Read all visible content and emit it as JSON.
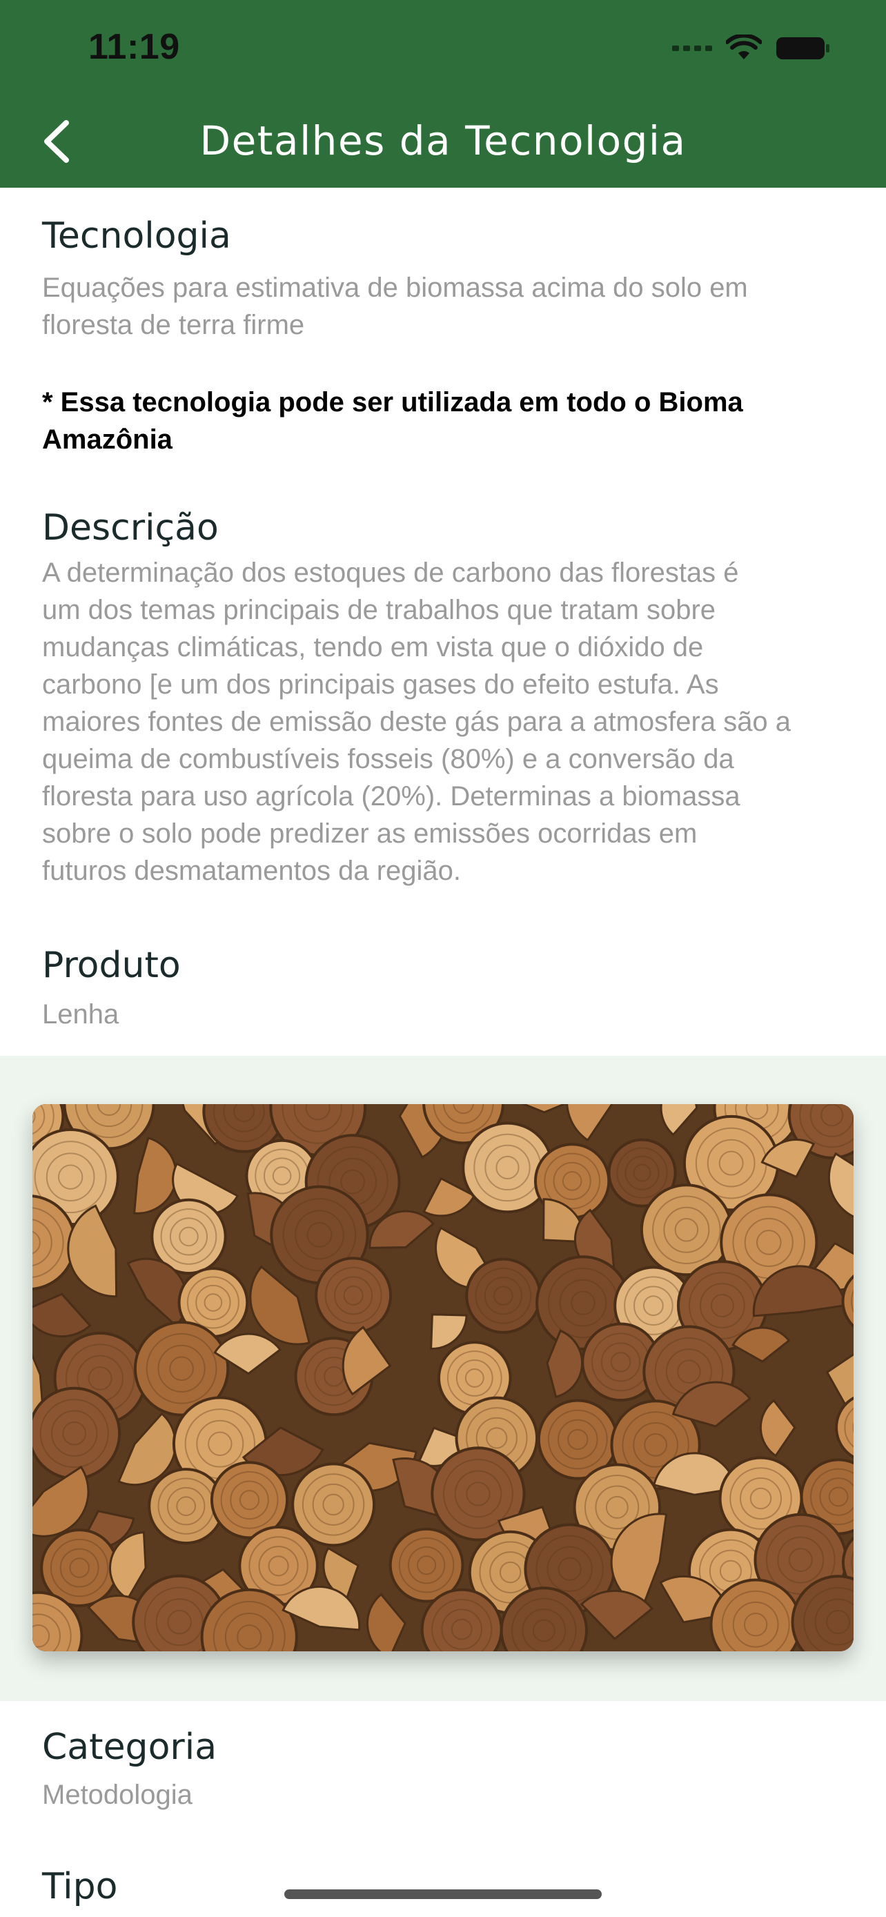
{
  "status_bar": {
    "time": "11:19"
  },
  "nav": {
    "title": "Detalhes da Tecnologia"
  },
  "tecnologia": {
    "label": "Tecnologia",
    "lines": [
      "Equações para estimativa de biomassa acima do solo em",
      "floresta de terra firme"
    ]
  },
  "note": {
    "lines": [
      "* Essa tecnologia pode ser utilizada em todo o Bioma",
      "Amazônia"
    ]
  },
  "descricao": {
    "label": "Descrição",
    "lines": [
      "A determinação dos estoques de carbono das florestas é",
      "um dos temas principais de trabalhos que tratam sobre",
      "mudanças climáticas, tendo em vista que o dióxido de",
      "carbono [e um dos principais gases do efeito estufa. As",
      "maiores fontes de emissão deste gás para a atmosfera são a",
      "queima de combustíveis fosseis (80%) e a conversão da",
      "floresta para uso agrícola (20%). Determinas a biomassa",
      "sobre o solo pode predizer as emissões ocorridas em",
      "futuros desmatamentos da região."
    ]
  },
  "produto": {
    "label": "Produto",
    "value": "Lenha"
  },
  "categoria": {
    "label": "Categoria",
    "value": "Metodologia"
  },
  "tipo": {
    "label": "Tipo"
  },
  "colors": {
    "header": "#2e6e3a",
    "image_bg": "#eef5ef",
    "value_text": "#9a9a9a"
  }
}
